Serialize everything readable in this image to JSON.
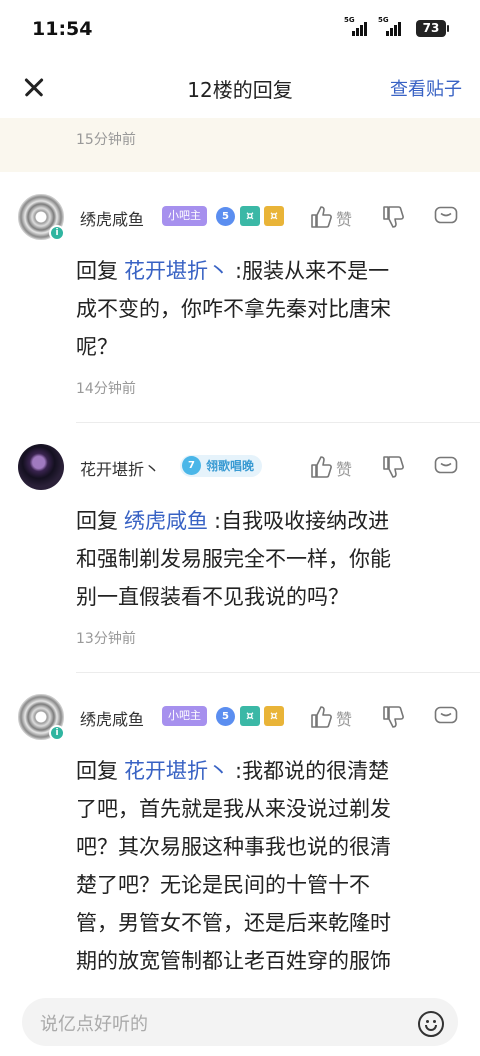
{
  "status_bar": {
    "time": "11:54",
    "network_1": "5G",
    "network_2": "5G",
    "battery": "73"
  },
  "header": {
    "title": "12楼的回复",
    "view_post_label": "查看贴子"
  },
  "previous_reply": {
    "time": "15分钟前"
  },
  "replies": [
    {
      "username": "绣虎咸鱼",
      "role_tag": "小吧主",
      "level": "5",
      "like_label": "赞",
      "reply_prefix": "回复",
      "reply_to": "花开堪折丶",
      "text_lines": [
        ":服装从来不是一",
        "成不变的，你咋不拿先秦对比唐宋",
        "呢？"
      ],
      "time": "14分钟前"
    },
    {
      "username": "花开堪折丶",
      "level": "7",
      "title_badge": "翎歌唱晚",
      "like_label": "赞",
      "reply_prefix": "回复",
      "reply_to": "绣虎咸鱼",
      "text_lines": [
        ":自我吸收接纳改进",
        "和强制剃发易服完全不一样，你能",
        "别一直假装看不见我说的吗？"
      ],
      "time": "13分钟前"
    },
    {
      "username": "绣虎咸鱼",
      "role_tag": "小吧主",
      "level": "5",
      "like_label": "赞",
      "reply_prefix": "回复",
      "reply_to": "花开堪折丶",
      "text_lines": [
        ":我都说的很清楚",
        "了吧，首先就是我从来没说过剃发",
        "吧？其次易服这种事我也说的很清",
        "楚了吧？无论是民间的十管十不",
        "管，男管女不管，还是后来乾隆时",
        "期的放宽管制都让老百姓穿的服饰"
      ]
    }
  ],
  "bottom_bar": {
    "placeholder": "说亿点好听的"
  },
  "colors": {
    "link_blue": "#3862c4",
    "xiaobazhu_purple": "#a690ee",
    "level_blue": "#5b8ef0",
    "highlight_bg": "#faf7ee"
  }
}
